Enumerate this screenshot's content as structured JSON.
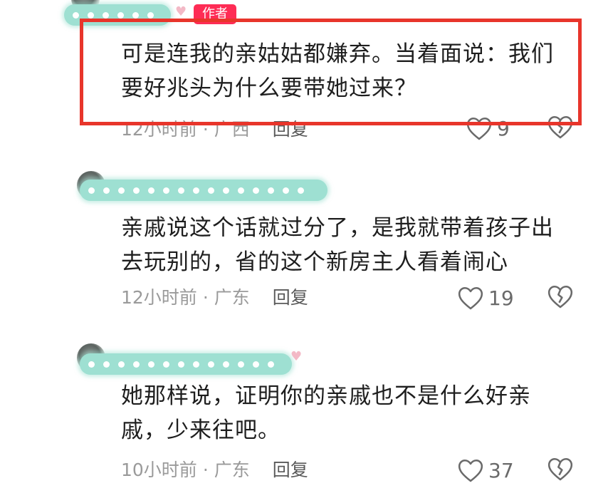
{
  "colors": {
    "accent_red": "#e8352b",
    "badge_pink": "#fe2c55",
    "mask_teal": "#9ee0d2"
  },
  "comments": [
    {
      "author_badge": "作者",
      "text": "可是连我的亲姑姑都嫌弃。当着面说：我们\n要好兆头为什么要带她过来？",
      "time": "12小时前",
      "location": "广西",
      "reply": "回复",
      "likes": "9",
      "highlighted": true
    },
    {
      "text": "亲戚说这个话就过分了，是我就带着孩子出\n去玩别的，省的这个新房主人看着闹心",
      "time": "12小时前",
      "location": "广东",
      "reply": "回复",
      "likes": "19"
    },
    {
      "text": "她那样说，证明你的亲戚也不是什么好亲\n戚，少来往吧。",
      "time": "10小时前",
      "location": "广东",
      "reply": "回复",
      "likes": "37"
    }
  ],
  "icons": {
    "like": "heart-outline-icon",
    "dislike": "broken-heart-icon",
    "author_heart": "small-heart-icon"
  }
}
